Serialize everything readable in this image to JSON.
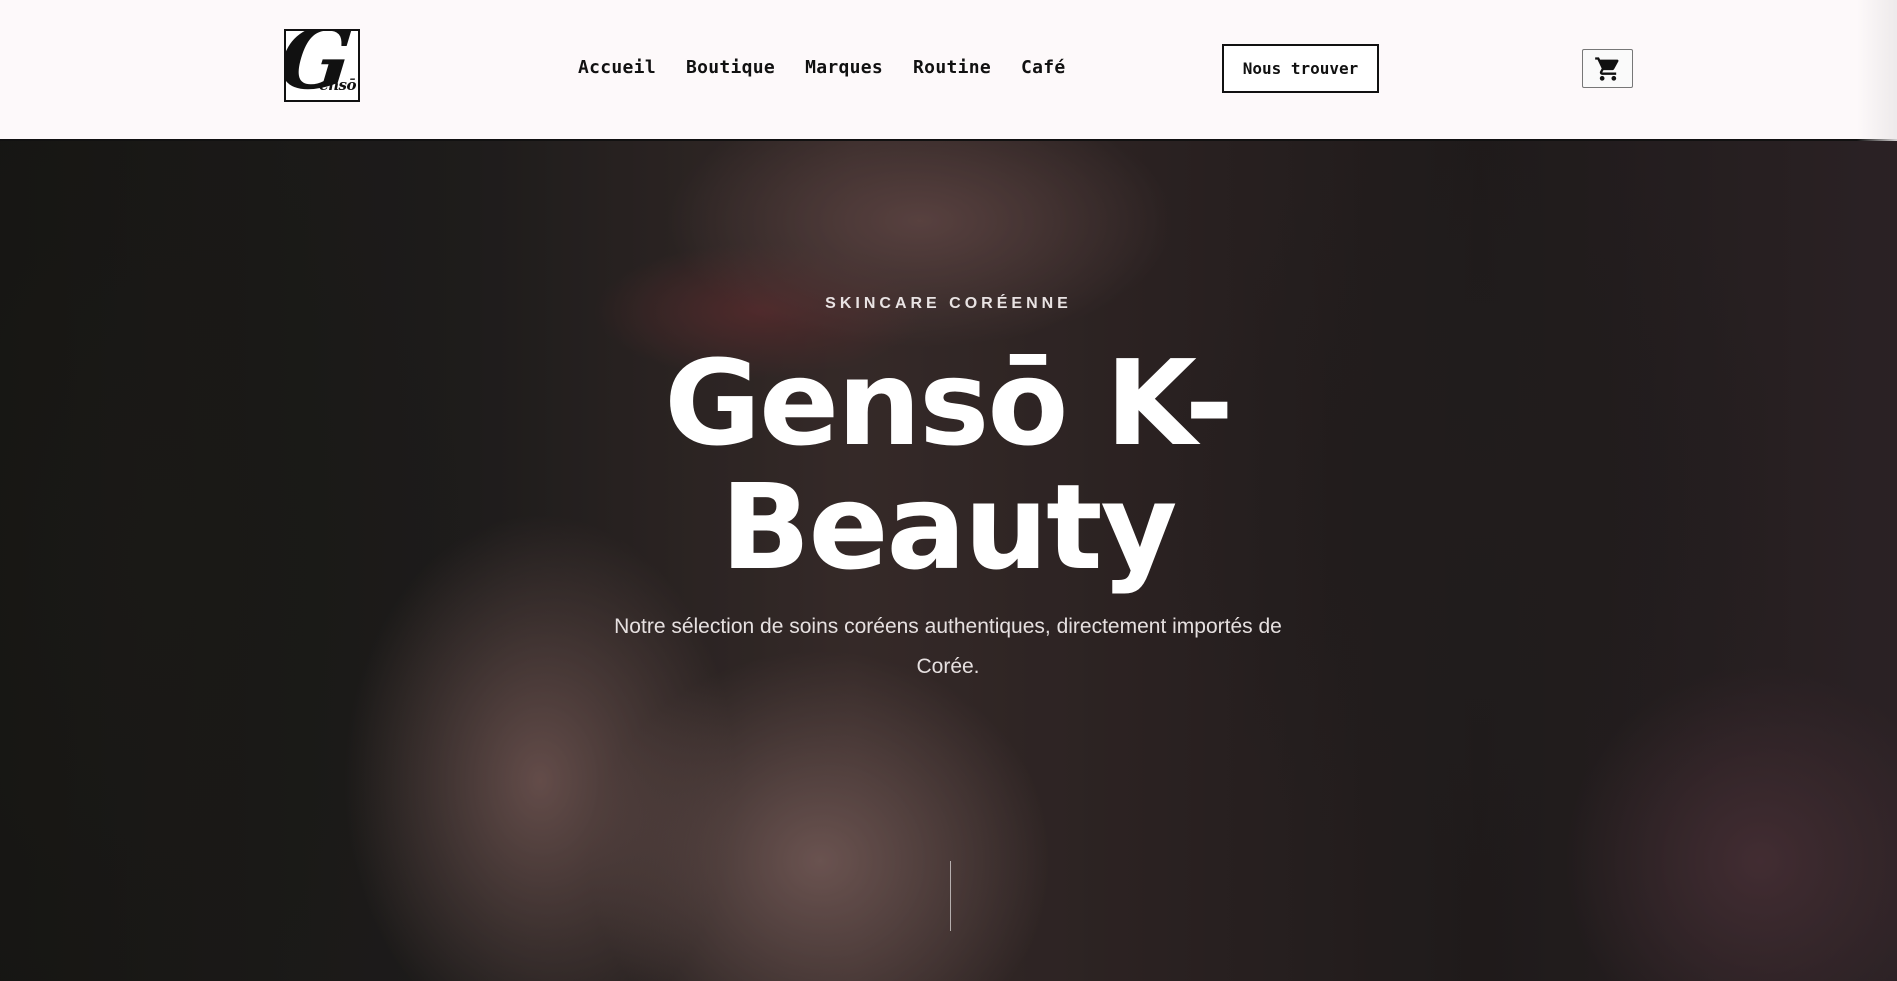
{
  "brand": {
    "logo_letter": "G",
    "logo_text": "ensō"
  },
  "nav": {
    "items": [
      {
        "label": "Accueil"
      },
      {
        "label": "Boutique"
      },
      {
        "label": "Marques"
      },
      {
        "label": "Routine"
      },
      {
        "label": "Café"
      }
    ]
  },
  "header": {
    "cta_label": "Nous trouver",
    "cart_icon": "cart-icon"
  },
  "hero": {
    "eyebrow": "SKINCARE CORÉENNE",
    "title": "Gensō K-Beauty",
    "subtitle": "Notre sélection de soins coréens authentiques, directement importés de Corée."
  },
  "colors": {
    "header_bg": "#fdf9fa",
    "text_dark": "#111111",
    "hero_text": "#ffffff"
  }
}
